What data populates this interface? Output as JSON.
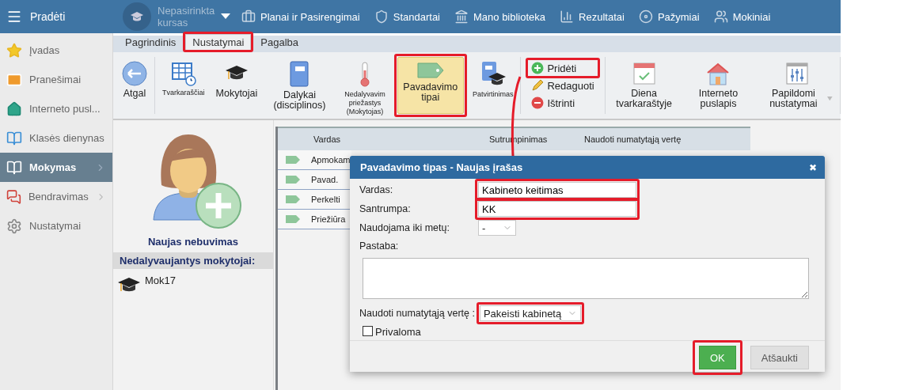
{
  "top_bar": {
    "menu_label": "Pradėti",
    "course": "Nepasirinkta kursas",
    "nav": [
      {
        "label": "Planai ir Pasirengimai",
        "kind": "briefcase"
      },
      {
        "label": "Standartai",
        "kind": "shield"
      },
      {
        "label": "Mano biblioteka",
        "kind": "library"
      },
      {
        "label": "Rezultatai",
        "kind": "chart"
      },
      {
        "label": "Pažymiai",
        "kind": "grade"
      },
      {
        "label": "Mokiniai",
        "kind": "students"
      }
    ]
  },
  "sidebar": {
    "items": [
      {
        "label": "Įvadas",
        "kind": "star",
        "selected": false,
        "has_arrow": false
      },
      {
        "label": "Pranešimai",
        "kind": "mail",
        "selected": false,
        "has_arrow": false
      },
      {
        "label": "Interneto pusl...",
        "kind": "home",
        "selected": false,
        "has_arrow": false
      },
      {
        "label": "Klasės dienynas",
        "kind": "book",
        "selected": false,
        "has_arrow": false
      },
      {
        "label": "Mokymas",
        "kind": "library",
        "selected": true,
        "has_arrow": true
      },
      {
        "label": "Bendravimas",
        "kind": "chat",
        "selected": false,
        "has_arrow": true
      },
      {
        "label": "Nustatymai",
        "kind": "gear",
        "selected": false,
        "has_arrow": false
      }
    ]
  },
  "ribbon": {
    "tabs": [
      {
        "label": "Pagrindinis",
        "selected": false,
        "highlighted": false
      },
      {
        "label": "Nustatymai",
        "selected": true,
        "highlighted": true
      },
      {
        "label": "Pagalba",
        "selected": false,
        "highlighted": false
      }
    ],
    "groups": [
      {
        "kind": "large",
        "items": [
          {
            "label": "Atgal",
            "kind": "back",
            "selected": false,
            "highlighted": false
          }
        ]
      },
      {
        "kind": "large",
        "items": [
          {
            "label": "Tvarkaraščiai",
            "kind": "timetable",
            "selected": false,
            "highlighted": false
          },
          {
            "label": "Mokytojai",
            "kind": "cap",
            "selected": false,
            "highlighted": false
          },
          {
            "label": "Dalykai (disciplinos)",
            "kind": "notebook",
            "selected": false,
            "highlighted": false
          },
          {
            "label": "Nedalyvavim priežastys (Mokytojas)",
            "kind": "thermometer",
            "selected": false,
            "highlighted": false
          },
          {
            "label": "Pavadavimo tipai",
            "kind": "tag",
            "selected": true,
            "highlighted": true
          },
          {
            "label": "Patvirtinimas",
            "kind": "approval",
            "selected": false,
            "highlighted": false
          }
        ]
      },
      {
        "kind": "small",
        "items": [
          {
            "label": "Pridėti",
            "kind": "add",
            "highlighted": true
          },
          {
            "label": "Redaguoti",
            "kind": "pencil",
            "highlighted": false
          },
          {
            "label": "Ištrinti",
            "kind": "remove",
            "highlighted": false
          }
        ]
      },
      {
        "kind": "large",
        "items": [
          {
            "label": "Diena tvarkaraštyje",
            "kind": "calendar",
            "selected": false,
            "highlighted": false
          },
          {
            "label": "Interneto puslapis",
            "kind": "house",
            "selected": false,
            "highlighted": false
          },
          {
            "label": "Papildomi nustatymai",
            "kind": "sliders",
            "selected": false,
            "highlighted": false,
            "has_caret": true
          }
        ]
      }
    ]
  },
  "absence_panel": {
    "new_button": "Naujas nebuvimas",
    "section_title": "Nedalyvaujantys mokytojai:",
    "teachers": [
      "Mok17"
    ]
  },
  "table": {
    "columns": [
      "Vardas",
      "Sutrumpinimas",
      "Naudoti numatytąją vertę"
    ],
    "rows": [
      {
        "name": "Apmokam"
      },
      {
        "name": "Pavad."
      },
      {
        "name": "Perkelti"
      },
      {
        "name": "Priežiūra"
      }
    ]
  },
  "dialog": {
    "title": "Pavadavimo tipas - Naujas įrašas",
    "close": "✖",
    "fields": [
      {
        "kind": "text",
        "label": "Vardas:",
        "value": "Kabineto keitimas",
        "highlighted": true
      },
      {
        "kind": "text",
        "label": "Santrumpa:",
        "value": "KK",
        "highlighted": true
      },
      {
        "kind": "select",
        "label": "Naudojama iki metų:",
        "value": "-",
        "highlighted": false
      },
      {
        "kind": "textarea",
        "label": "Pastaba:",
        "highlighted": false
      },
      {
        "kind": "select",
        "label": "Naudoti numatytąją vertę :",
        "value": "Pakeisti kabinetą",
        "highlighted": true
      },
      {
        "kind": "checkbox",
        "label": "Privaloma",
        "checked": false,
        "highlighted": false
      }
    ],
    "buttons": [
      {
        "label": "OK",
        "kind": "ok",
        "highlighted": true
      },
      {
        "label": "Atšaukti",
        "kind": "cancel",
        "highlighted": false
      }
    ]
  },
  "annotation_arrow": true
}
